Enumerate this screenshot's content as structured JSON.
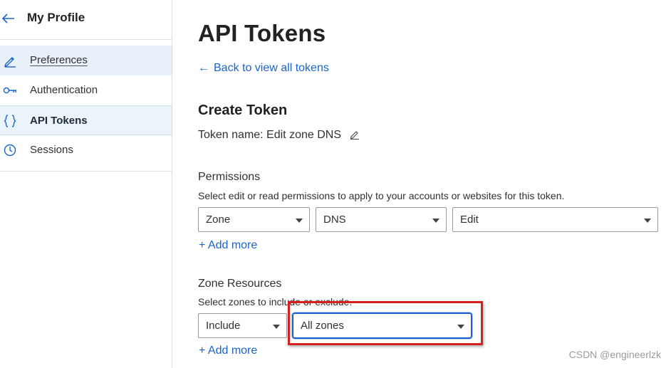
{
  "sidebar": {
    "title": "My Profile",
    "items": [
      {
        "label": "Preferences",
        "icon": "pencil-icon"
      },
      {
        "label": "Authentication",
        "icon": "key-icon"
      },
      {
        "label": "API Tokens",
        "icon": "braces-icon"
      },
      {
        "label": "Sessions",
        "icon": "clock-icon"
      }
    ],
    "active": "API Tokens"
  },
  "main": {
    "title": "API Tokens",
    "back_link": "Back to view all tokens",
    "section_title": "Create Token",
    "token_name": "Token name: Edit zone DNS",
    "permissions": {
      "title": "Permissions",
      "description": "Select edit or read permissions to apply to your accounts or websites for this token.",
      "selects": [
        "Zone",
        "DNS",
        "Edit"
      ],
      "add_more": "+ Add more"
    },
    "zone_resources": {
      "title": "Zone Resources",
      "description": "Select zones to include or exclude.",
      "selects": [
        "Include",
        "All zones"
      ],
      "add_more": "+ Add more"
    }
  },
  "colors": {
    "link": "#1a65c9",
    "highlight": "#d61f1f",
    "active_bg": "#ebf3fb"
  },
  "watermark": "CSDN @engineerlzk"
}
